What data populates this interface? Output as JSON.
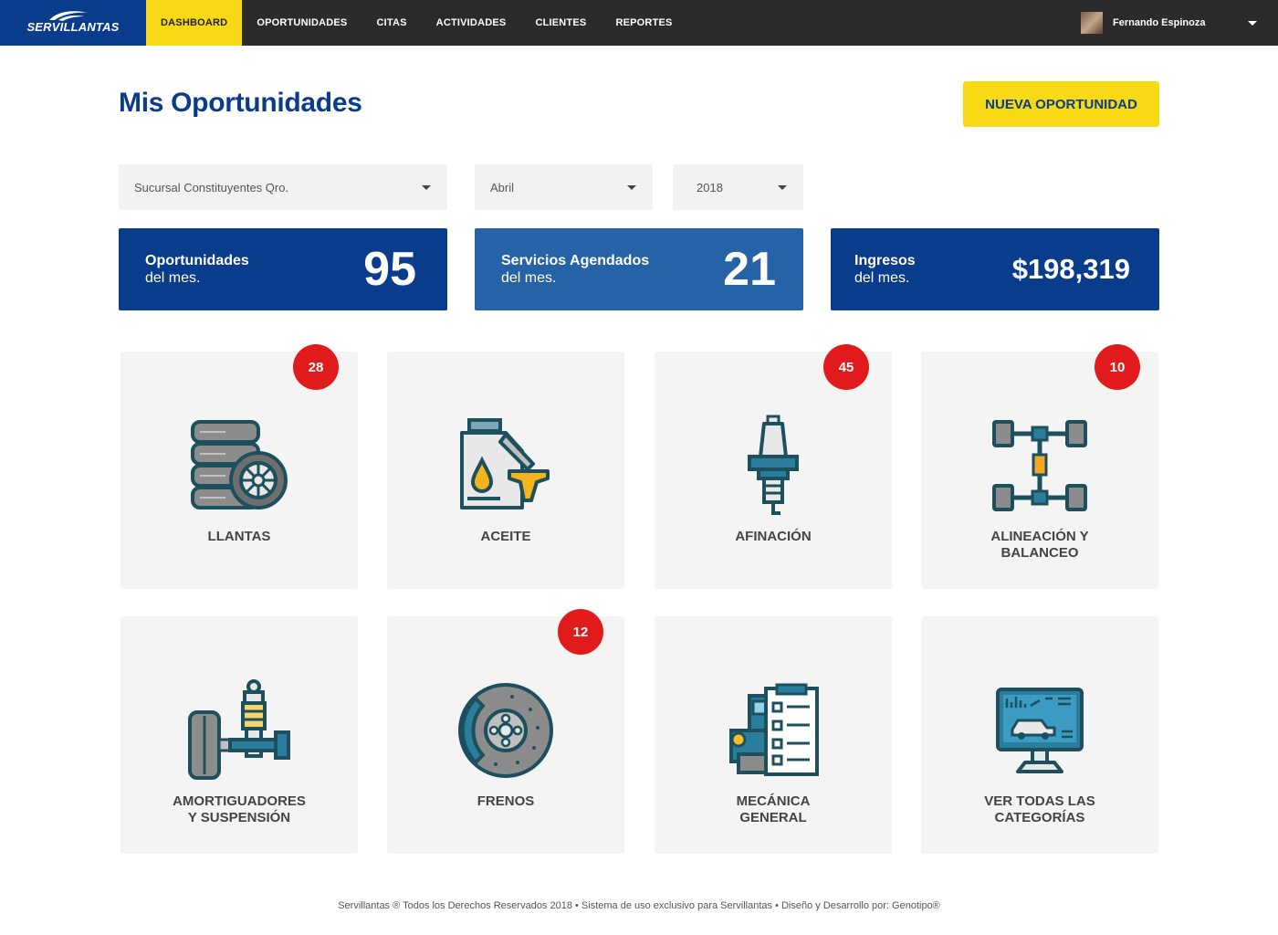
{
  "brand": {
    "logo_text": "SERVILLANTAS",
    "primary": "#0a3c8c",
    "accent": "#f7d916",
    "badge": "#e11b1b"
  },
  "nav": {
    "items": [
      {
        "label": "DASHBOARD",
        "active": true
      },
      {
        "label": "OPORTUNIDADES"
      },
      {
        "label": "CITAS"
      },
      {
        "label": "ACTIVIDADES"
      },
      {
        "label": "CLIENTES"
      },
      {
        "label": "REPORTES"
      }
    ]
  },
  "user": {
    "name": "Fernando Espinoza"
  },
  "page": {
    "title": "Mis Oportunidades",
    "new_button": "NUEVA OPORTUNIDAD"
  },
  "filters": {
    "branch": "Sucursal Constituyentes Qro.",
    "month": "Abril",
    "year": "2018"
  },
  "stats": [
    {
      "label_1": "Oportunidades",
      "label_2": "del mes.",
      "value": "95"
    },
    {
      "label_1": "Servicios Agendados",
      "label_2": "del mes.",
      "value": "21"
    },
    {
      "label_1": "Ingresos",
      "label_2": "del mes.",
      "value": "$198,319"
    }
  ],
  "categories": [
    {
      "line1": "LLANTAS",
      "line2": "",
      "badge": "28",
      "icon": "tires-icon"
    },
    {
      "line1": "ACEITE",
      "line2": "",
      "badge": "",
      "icon": "oil-icon"
    },
    {
      "line1": "AFINACIÓN",
      "line2": "",
      "badge": "45",
      "icon": "spark-plug-icon"
    },
    {
      "line1": "ALINEACIÓN Y",
      "line2": "BALANCEO",
      "badge": "10",
      "icon": "axle-icon"
    },
    {
      "line1": "AMORTIGUADORES",
      "line2": "Y SUSPENSIÓN",
      "badge": "",
      "icon": "shock-absorber-icon"
    },
    {
      "line1": "FRENOS",
      "line2": "",
      "badge": "12",
      "icon": "brake-disc-icon"
    },
    {
      "line1": "MECÁNICA",
      "line2": "GENERAL",
      "badge": "",
      "icon": "mechanic-checklist-icon"
    },
    {
      "line1": "VER TODAS LAS",
      "line2": "CATEGORÍAS",
      "badge": "",
      "icon": "monitor-car-icon"
    }
  ],
  "footer": {
    "text": "Servillantas ® Todos los Derechos Reservados 2018 • Sistema de uso exclusivo para Servillantas • Diseño y Desarrollo por: Genotipo®"
  }
}
